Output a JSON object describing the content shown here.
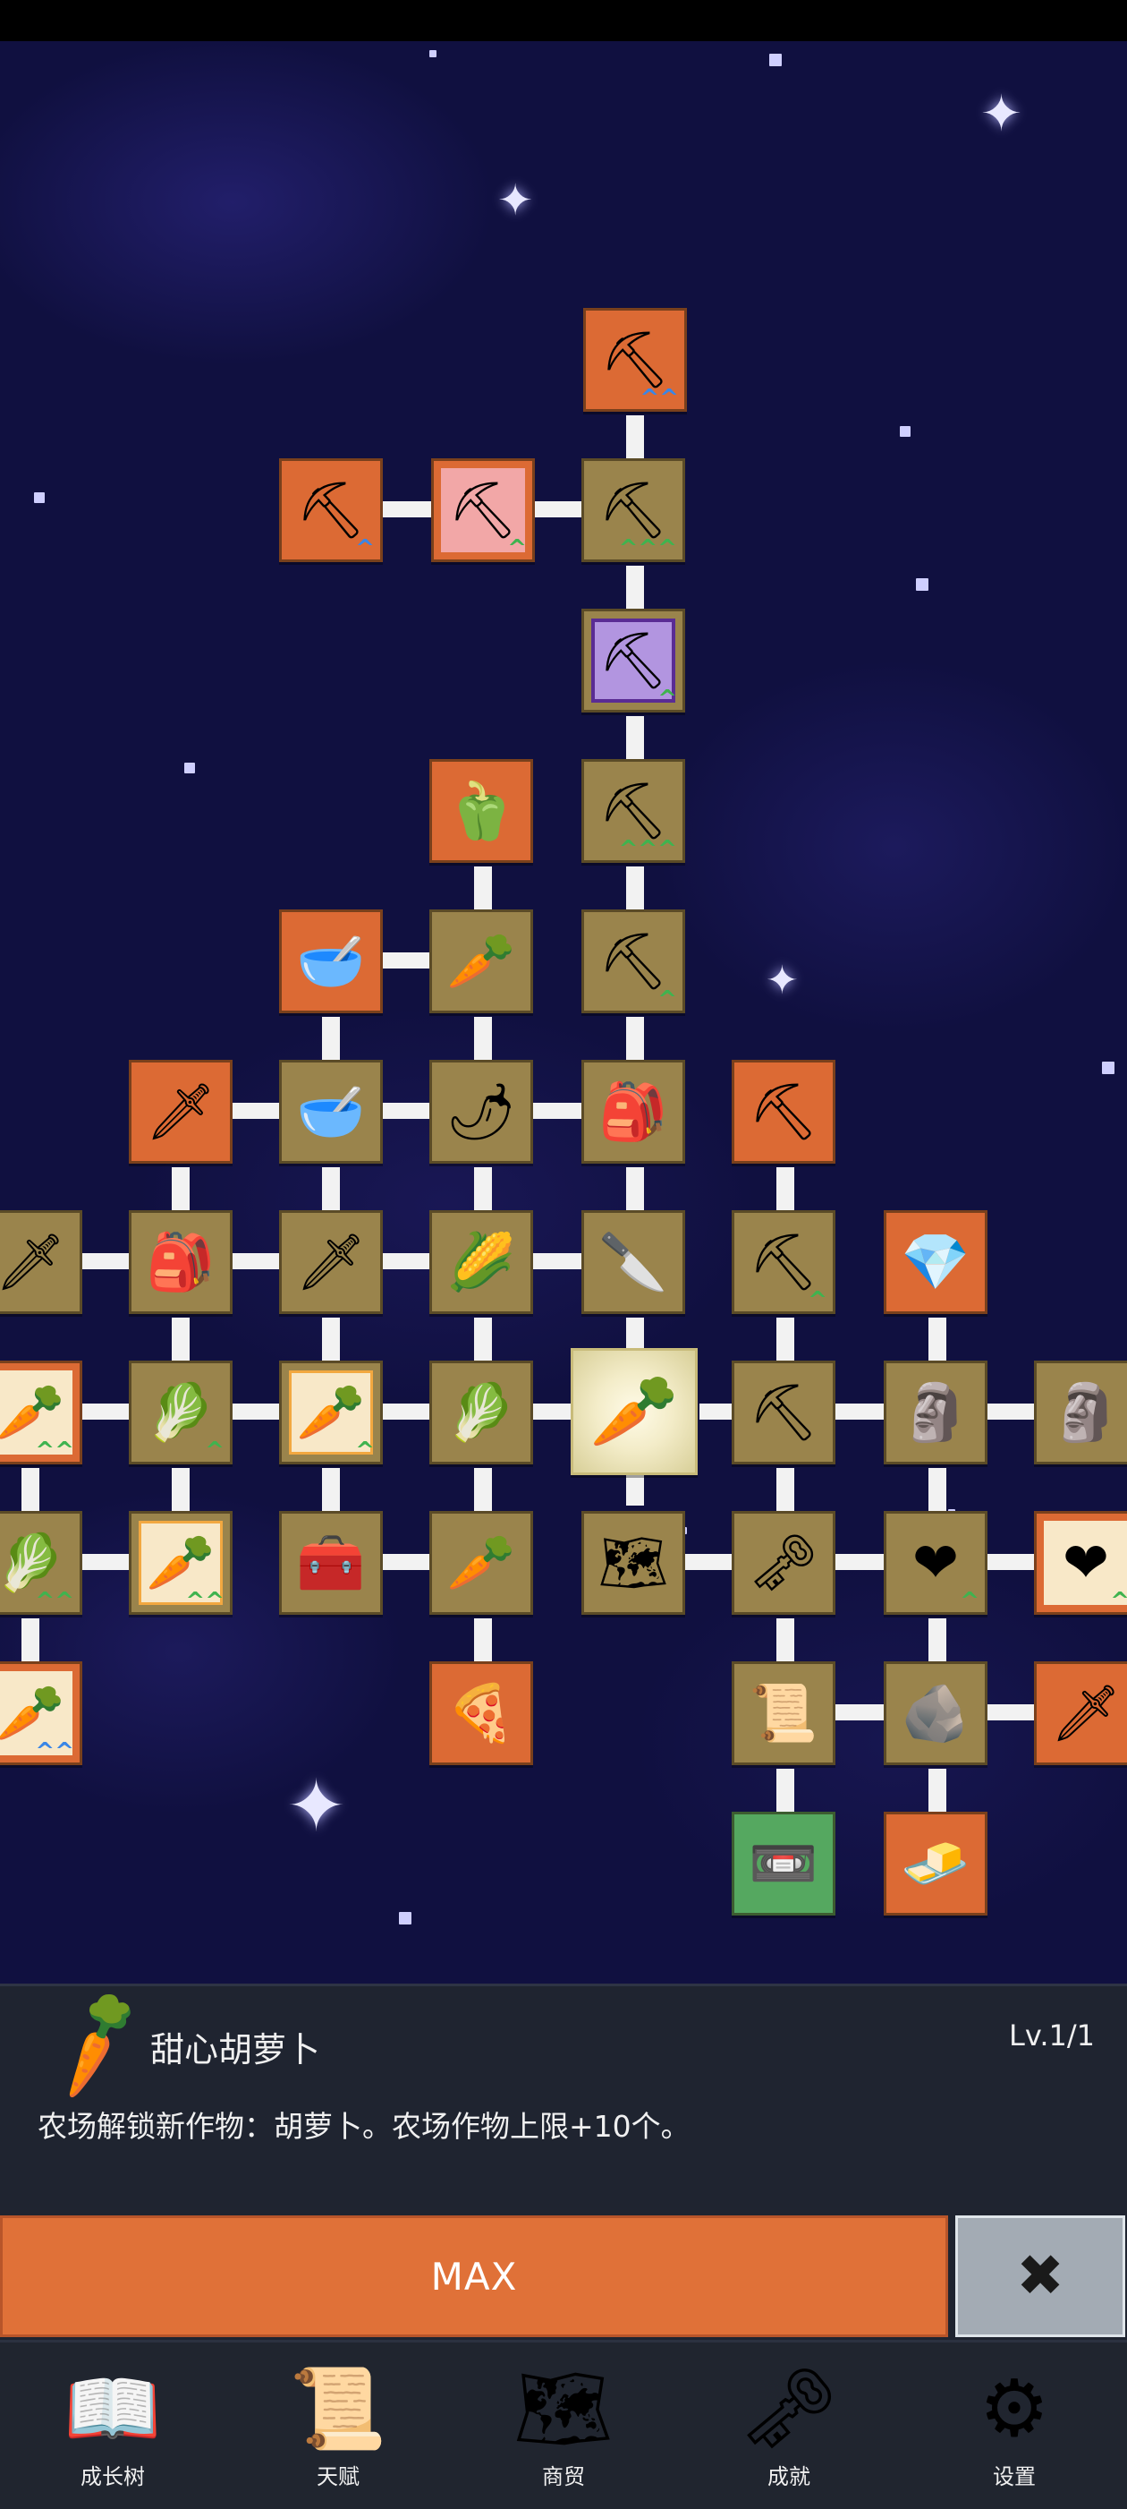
{
  "skill_tree": {
    "nodes": [
      {
        "icon": "shovel-icon",
        "glyph": "⛏",
        "badge": "^^",
        "badge_color": "blue"
      },
      {
        "icon": "shovel-icon",
        "glyph": "⛏",
        "badge": "^",
        "badge_color": "blue"
      },
      {
        "icon": "shovel-icon",
        "glyph": "⛏",
        "badge": "^",
        "badge_color": "green"
      },
      {
        "icon": "shovel-icon",
        "glyph": "⛏",
        "badge": "^^^",
        "badge_color": "green"
      },
      {
        "icon": "shovel-icon",
        "glyph": "⛏",
        "badge": "^",
        "badge_color": "green"
      },
      {
        "icon": "pepper-icon",
        "glyph": "🫑",
        "badge": "",
        "badge_color": ""
      },
      {
        "icon": "shovel-icon",
        "glyph": "⛏",
        "badge": "^^^",
        "badge_color": "green"
      },
      {
        "icon": "bowl-icon",
        "glyph": "🥣",
        "badge": "",
        "badge_color": ""
      },
      {
        "icon": "radish-icon",
        "glyph": "🥕",
        "badge": "",
        "badge_color": ""
      },
      {
        "icon": "shovel-icon",
        "glyph": "⛏",
        "badge": "^",
        "badge_color": "green"
      },
      {
        "icon": "sword-icon",
        "glyph": "🗡",
        "badge": "",
        "badge_color": ""
      },
      {
        "icon": "bowl-icon",
        "glyph": "🥣",
        "badge": "",
        "badge_color": ""
      },
      {
        "icon": "chili-icon",
        "glyph": "🌶",
        "badge": "",
        "badge_color": ""
      },
      {
        "icon": "backpack-icon",
        "glyph": "🎒",
        "badge": "",
        "badge_color": ""
      },
      {
        "icon": "pickaxe-icon",
        "glyph": "⛏",
        "badge": "",
        "badge_color": ""
      },
      {
        "icon": "sword-icon",
        "glyph": "🗡",
        "badge": "",
        "badge_color": ""
      },
      {
        "icon": "backpack-icon",
        "glyph": "🎒",
        "badge": "",
        "badge_color": ""
      },
      {
        "icon": "sword-icon",
        "glyph": "🗡",
        "badge": "",
        "badge_color": ""
      },
      {
        "icon": "corn-icon",
        "glyph": "🌽",
        "badge": "",
        "badge_color": ""
      },
      {
        "icon": "dagger-icon",
        "glyph": "🔪",
        "badge": "",
        "badge_color": ""
      },
      {
        "icon": "pickaxe-icon",
        "glyph": "⛏",
        "badge": "^",
        "badge_color": "green"
      },
      {
        "icon": "crystal-icon",
        "glyph": "💎",
        "badge": "",
        "badge_color": ""
      },
      {
        "icon": "carrot-icon",
        "glyph": "🥕",
        "badge": "^^",
        "badge_color": "green"
      },
      {
        "icon": "cabbage-icon",
        "glyph": "🥬",
        "badge": "^",
        "badge_color": "green"
      },
      {
        "icon": "carrot-icon",
        "glyph": "🥕",
        "badge": "^",
        "badge_color": "green"
      },
      {
        "icon": "cabbage-icon",
        "glyph": "🥬",
        "badge": "",
        "badge_color": ""
      },
      {
        "icon": "carrot-icon",
        "glyph": "🥕",
        "badge": "",
        "badge_color": ""
      },
      {
        "icon": "pickaxe-icon",
        "glyph": "⛏",
        "badge": "",
        "badge_color": ""
      },
      {
        "icon": "statue-icon",
        "glyph": "🗿",
        "badge": "",
        "badge_color": ""
      },
      {
        "icon": "statue-icon",
        "glyph": "🗿",
        "badge": "",
        "badge_color": ""
      },
      {
        "icon": "cabbage-icon",
        "glyph": "🥬",
        "badge": "^^",
        "badge_color": "green"
      },
      {
        "icon": "carrot-icon",
        "glyph": "🥕",
        "badge": "^^",
        "badge_color": "green"
      },
      {
        "icon": "chest-icon",
        "glyph": "🧰",
        "badge": "",
        "badge_color": ""
      },
      {
        "icon": "parsnip-icon",
        "glyph": "🥕",
        "badge": "",
        "badge_color": ""
      },
      {
        "icon": "map-icon",
        "glyph": "🗺",
        "badge": "",
        "badge_color": ""
      },
      {
        "icon": "key-icon",
        "glyph": "🗝",
        "badge": "",
        "badge_color": ""
      },
      {
        "icon": "heart-icon",
        "glyph": "❤",
        "badge": "^",
        "badge_color": "green"
      },
      {
        "icon": "heart-icon",
        "glyph": "❤",
        "badge": "^",
        "badge_color": "green"
      },
      {
        "icon": "carrot-icon",
        "glyph": "🥕",
        "badge": "^^",
        "badge_color": "blue"
      },
      {
        "icon": "pizza-icon",
        "glyph": "🍕",
        "badge": "",
        "badge_color": ""
      },
      {
        "icon": "scroll-icon",
        "glyph": "📜",
        "badge": "",
        "badge_color": ""
      },
      {
        "icon": "stone-icon",
        "glyph": "🪨",
        "badge": "",
        "badge_color": ""
      },
      {
        "icon": "sword-icon",
        "glyph": "🗡",
        "badge": "",
        "badge_color": ""
      },
      {
        "icon": "cassette-icon",
        "glyph": "📼",
        "badge": "",
        "badge_color": ""
      },
      {
        "icon": "gold-bar-icon",
        "glyph": "🧈",
        "badge": "",
        "badge_color": ""
      }
    ],
    "selected_node": {
      "icon": "carrot-icon",
      "glyph": "🥕"
    }
  },
  "detail_panel": {
    "icon": "carrot-icon",
    "icon_glyph": "🥕",
    "title": "甜心胡萝卜",
    "level": "Lv.1/1",
    "description": "农场解锁新作物：胡萝卜。农场作物上限+10个。",
    "max_button_label": "MAX",
    "close_icon": "close-icon",
    "close_glyph": "✖"
  },
  "nav": {
    "items": [
      {
        "label": "成长树",
        "icon": "book-icon",
        "glyph": "📖"
      },
      {
        "label": "天赋",
        "icon": "scroll-icon",
        "glyph": "📜"
      },
      {
        "label": "商贸",
        "icon": "map-icon",
        "glyph": "🗺"
      },
      {
        "label": "成就",
        "icon": "key-icon",
        "glyph": "🗝"
      },
      {
        "label": "设置",
        "icon": "gear-icon",
        "glyph": "⚙"
      }
    ]
  },
  "colors": {
    "space": "#101040",
    "node_tan": "#9a844c",
    "node_orange": "#dc6a34",
    "node_green": "#55a860",
    "max_button": "#e07138",
    "close_button": "#a3abb4",
    "panel": "#1f2430"
  }
}
